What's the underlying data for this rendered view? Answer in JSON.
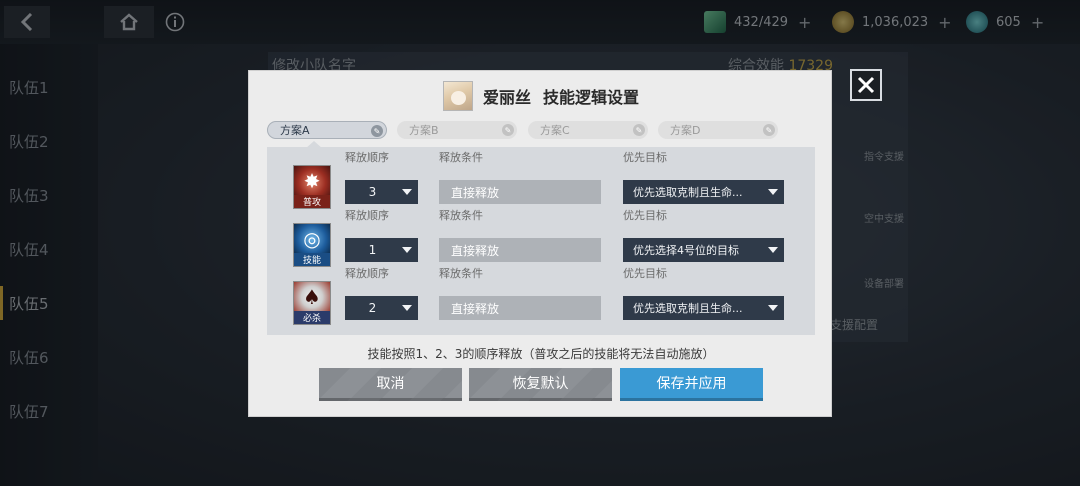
{
  "topbar": {
    "resources": [
      {
        "icon": "energy-crystal-icon",
        "value": "432/429"
      },
      {
        "icon": "gold-coin-icon",
        "value": "1,036,023"
      },
      {
        "icon": "gem-icon",
        "value": "605"
      }
    ]
  },
  "sidebar": {
    "teams": [
      "队伍1",
      "队伍2",
      "队伍3",
      "队伍4",
      "队伍5",
      "队伍6",
      "队伍7"
    ],
    "active_index": 4
  },
  "background": {
    "squad_name": "修改小队名字",
    "power_label": "综合效能",
    "power_value": "17329",
    "side_labels": [
      "指令支援",
      "空中支援",
      "设备部署"
    ],
    "support_config": "支援配置"
  },
  "dialog": {
    "character_name": "爱丽丝",
    "title": "技能逻辑设置",
    "close_icon": "close-x-icon",
    "tabs": [
      "方案A",
      "方案B",
      "方案C",
      "方案D"
    ],
    "active_tab": 0,
    "column_labels": {
      "order": "释放顺序",
      "condition": "释放条件",
      "target": "优先目标"
    },
    "skills": [
      {
        "tag": "普攻",
        "icon": "normal-attack-icon",
        "order": "3",
        "condition": "直接释放",
        "target": "优先选取克制且生命..."
      },
      {
        "tag": "技能",
        "icon": "skill-icon",
        "order": "1",
        "condition": "直接释放",
        "target": "优先选择4号位的目标"
      },
      {
        "tag": "必杀",
        "icon": "ultimate-icon",
        "order": "2",
        "condition": "直接释放",
        "target": "优先选取克制且生命..."
      }
    ],
    "hint": "技能按照1、2、3的顺序释放（普攻之后的技能将无法自动施放）",
    "buttons": {
      "cancel": "取消",
      "reset": "恢复默认",
      "save": "保存并应用"
    }
  },
  "colors": {
    "accent_blue": "#3a9ad4",
    "select_dark": "#2f3a49",
    "active_team_marker": "#e1b23a"
  }
}
